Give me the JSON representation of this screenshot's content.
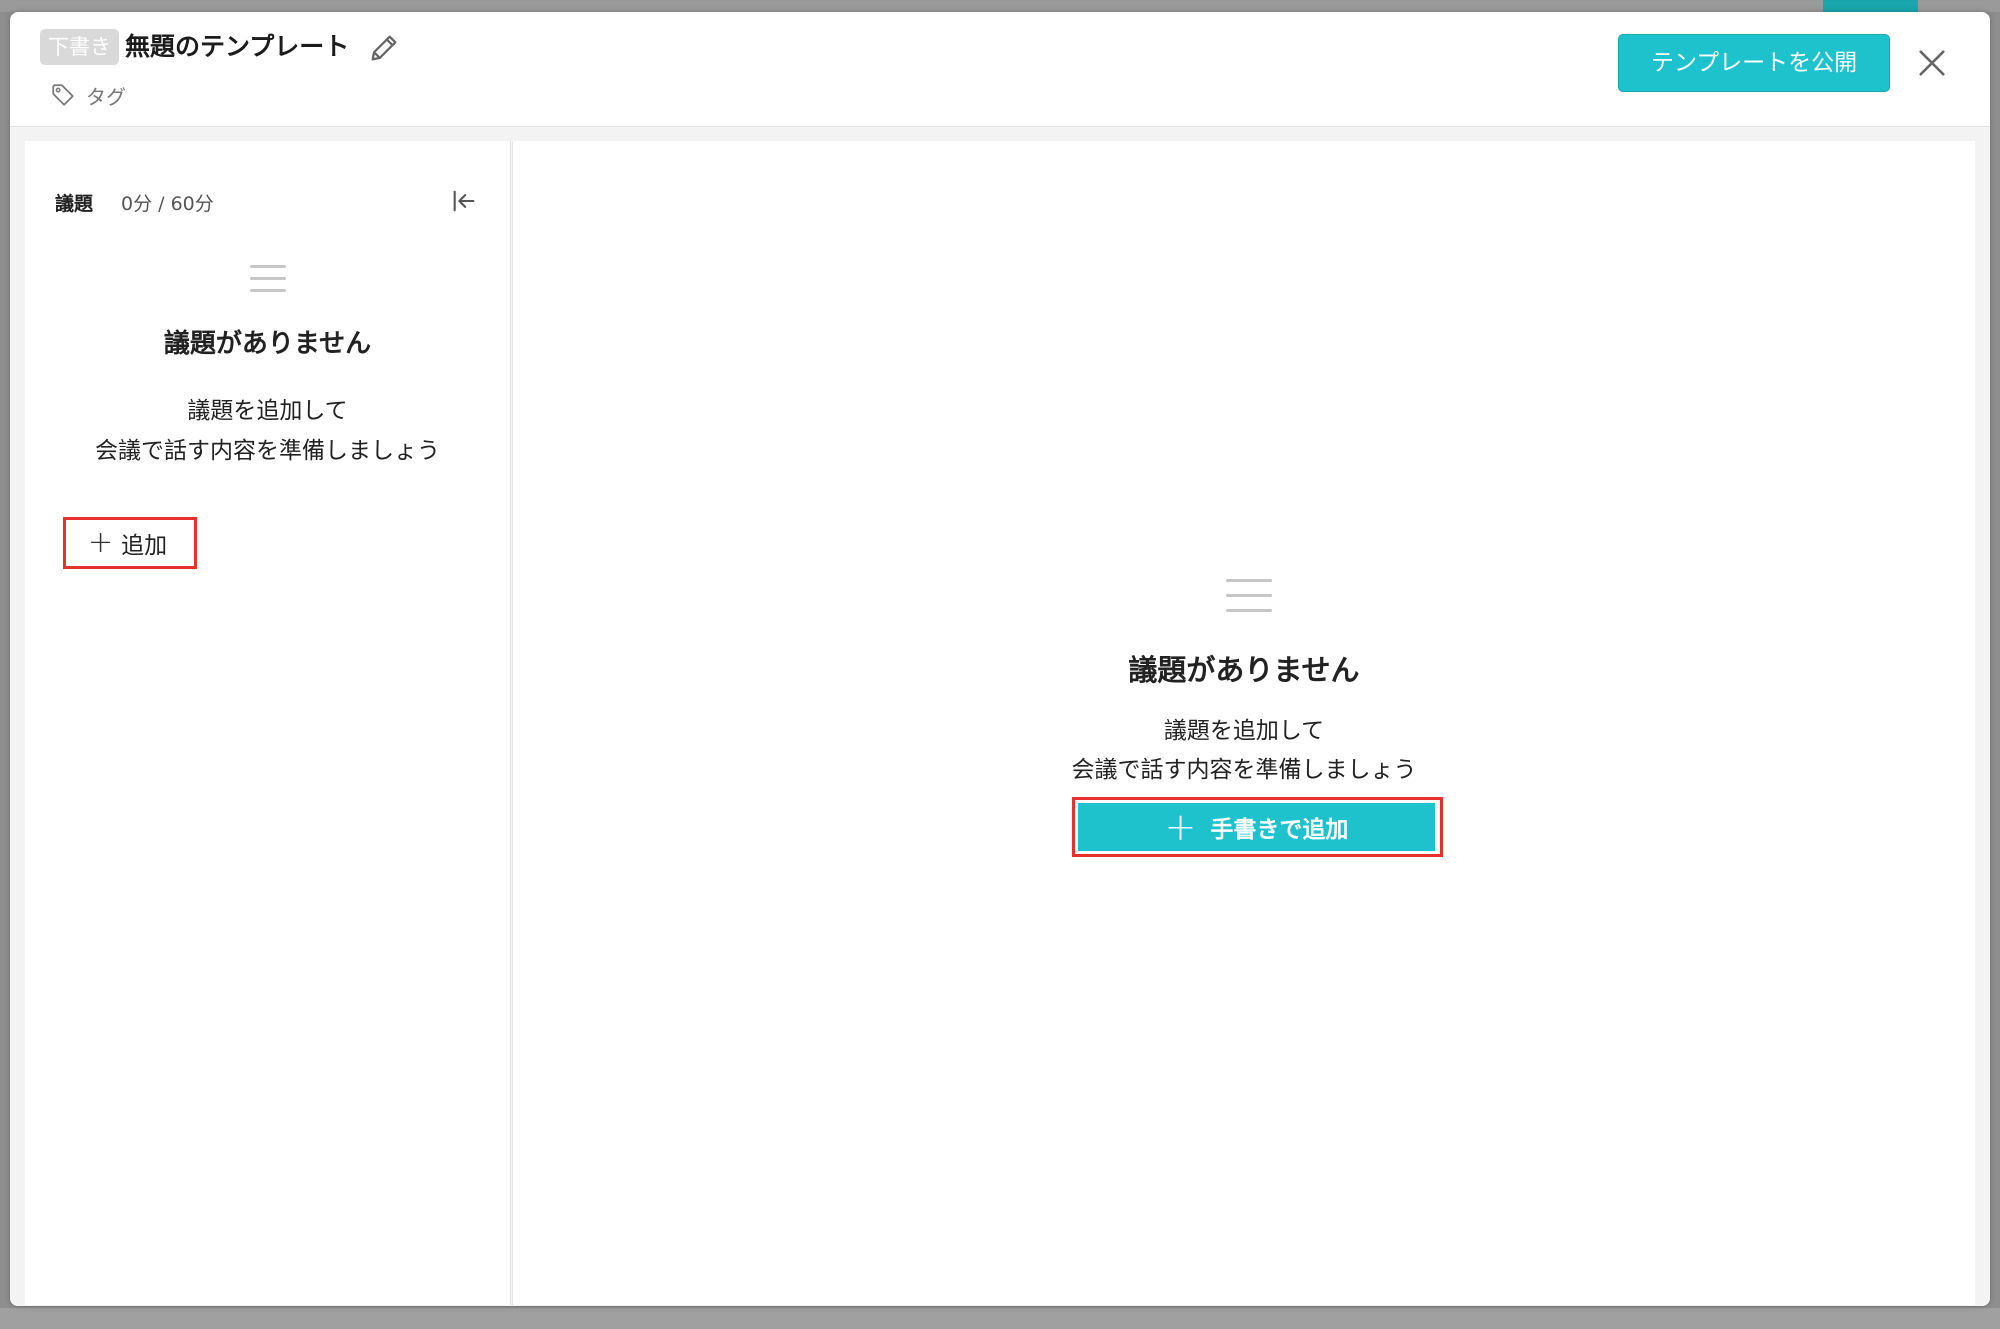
{
  "header": {
    "badge": "下書き",
    "title": "無題のテンプレート",
    "tag_label": "タグ",
    "publish_label": "テンプレートを公開"
  },
  "sidebar": {
    "title": "議題",
    "time": "0分 / 60分",
    "empty_title": "議題がありません",
    "empty_line1": "議題を追加して",
    "empty_line2": "会議で話す内容を準備しましょう",
    "add_label": "追加"
  },
  "main": {
    "empty_title": "議題がありません",
    "empty_line1": "議題を追加して",
    "empty_line2": "会議で話す内容を準備しましょう",
    "add_label": "手書きで追加"
  },
  "colors": {
    "accent": "#1ec2cc",
    "highlight": "#e5322d"
  }
}
